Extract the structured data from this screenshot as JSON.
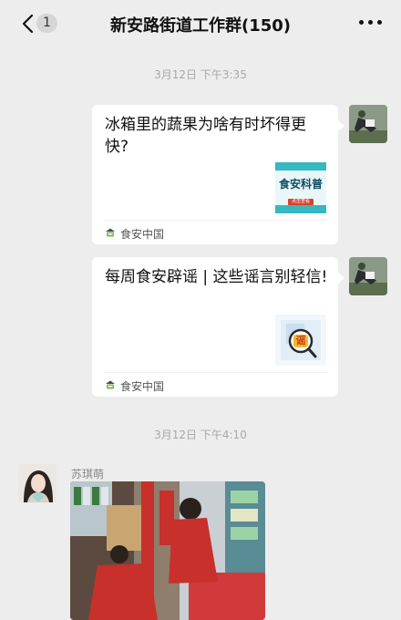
{
  "header": {
    "unread_count": "1",
    "title": "新安路街道工作群(150)",
    "back_icon": "chevron-left-icon",
    "more_icon": "more-dots-icon"
  },
  "messages": [
    {
      "type": "time",
      "text": "3月12日 下午3:35"
    },
    {
      "type": "link_card",
      "side": "right",
      "title": "冰箱里的蔬果为啥有时坏得更快?",
      "thumb_text": "食安科普",
      "thumb_button": "点击查看",
      "source": "食安中国"
    },
    {
      "type": "link_card",
      "side": "right",
      "title": "每周食安辟谣 | 这些谣言别轻信!",
      "thumb_text": "谣",
      "source": "食安中国"
    },
    {
      "type": "time",
      "text": "3月12日 下午4:10"
    },
    {
      "type": "image",
      "side": "left",
      "sender": "苏琪萌"
    }
  ],
  "colors": {
    "background": "#ededed",
    "bubble": "#ffffff",
    "timestamp": "#a9a9a9",
    "thumb_teal": "#35b8bf",
    "thumb_text": "#0f4c63",
    "thumb_button": "#d9412d"
  }
}
